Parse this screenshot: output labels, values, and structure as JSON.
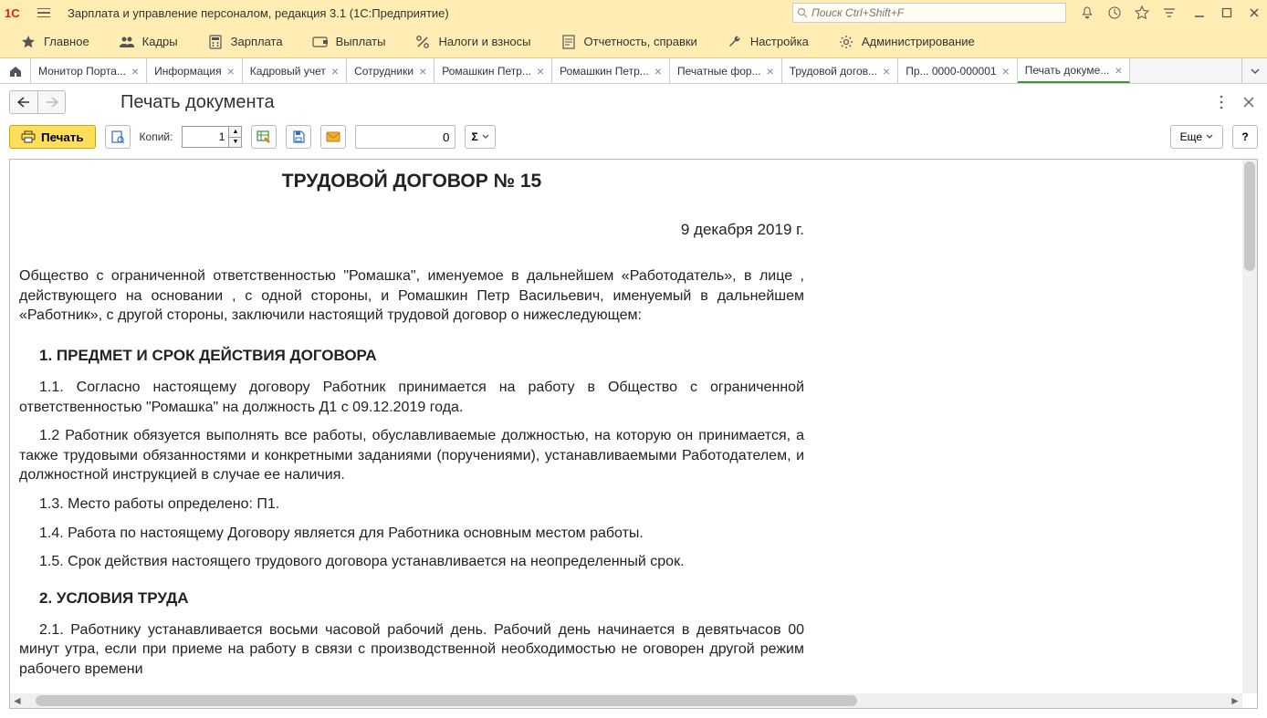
{
  "app": {
    "title": "Зарплата и управление персоналом, редакция 3.1  (1С:Предприятие)",
    "search_placeholder": "Поиск Ctrl+Shift+F"
  },
  "menu": [
    {
      "icon": "star",
      "label": "Главное"
    },
    {
      "icon": "people",
      "label": "Кадры"
    },
    {
      "icon": "calc",
      "label": "Зарплата"
    },
    {
      "icon": "wallet",
      "label": "Выплаты"
    },
    {
      "icon": "percent",
      "label": "Налоги и взносы"
    },
    {
      "icon": "report",
      "label": "Отчетность, справки"
    },
    {
      "icon": "wrench",
      "label": "Настройка"
    },
    {
      "icon": "gear",
      "label": "Администрирование"
    }
  ],
  "tabs": [
    {
      "label": "Монитор Порта...",
      "closable": true
    },
    {
      "label": "Информация",
      "closable": true
    },
    {
      "label": "Кадровый учет",
      "closable": true
    },
    {
      "label": "Сотрудники",
      "closable": true
    },
    {
      "label": "Ромашкин Петр...",
      "closable": true
    },
    {
      "label": "Ромашкин Петр...",
      "closable": true
    },
    {
      "label": "Печатные фор...",
      "closable": true
    },
    {
      "label": "Трудовой догов...",
      "closable": true
    },
    {
      "label": "Пр... 0000-000001",
      "closable": true
    },
    {
      "label": "Печать докуме...",
      "closable": true,
      "active": true
    }
  ],
  "page": {
    "title": "Печать документа"
  },
  "toolbar": {
    "print_label": "Печать",
    "copies_label": "Копий:",
    "copies_value": "1",
    "num_value": "0",
    "more_label": "Еще",
    "help_label": "?"
  },
  "doc": {
    "title": "ТРУДОВОЙ ДОГОВОР № 15",
    "date": "9 декабря 2019 г.",
    "intro": "Общество с ограниченной ответственностью \"Ромашка\", именуемое в дальнейшем «Работодатель», в лице , действующего на основании , с одной стороны, и Ромашкин Петр Васильевич, именуемый в дальнейшем «Работник», с другой стороны, заключили настоящий трудовой договор о нижеследующем:",
    "sec1_title": "1. ПРЕДМЕТ И СРОК ДЕЙСТВИЯ ДОГОВОРА",
    "p1_1": "1.1. Согласно настоящему договору Работник принимается на работу в Общество с ограниченной ответственностью \"Ромашка\" на должность Д1 с 09.12.2019 года.",
    "p1_2": "1.2 Работник обязуется выполнять все работы, обуславливаемые должностью, на которую он принимается, а также трудовыми обязанностями и конкретными заданиями (поручениями), устанавливаемыми Работодателем, и должностной инструкцией в случае ее наличия.",
    "p1_3": "1.3. Место работы определено: П1.",
    "p1_4": "1.4. Работа по настоящему Договору является для Работника основным местом работы.",
    "p1_5": "1.5. Срок действия настоящего трудового договора устанавливается на неопределенный срок.",
    "sec2_title": "2. УСЛОВИЯ ТРУДА",
    "p2_1": "2.1. Работнику устанавливается восьми часовой рабочий день. Рабочий день начинается в девятьчасов 00 минут утра, если при приеме на работу в связи с производственной необходимостью не оговорен другой режим рабочего времени"
  }
}
